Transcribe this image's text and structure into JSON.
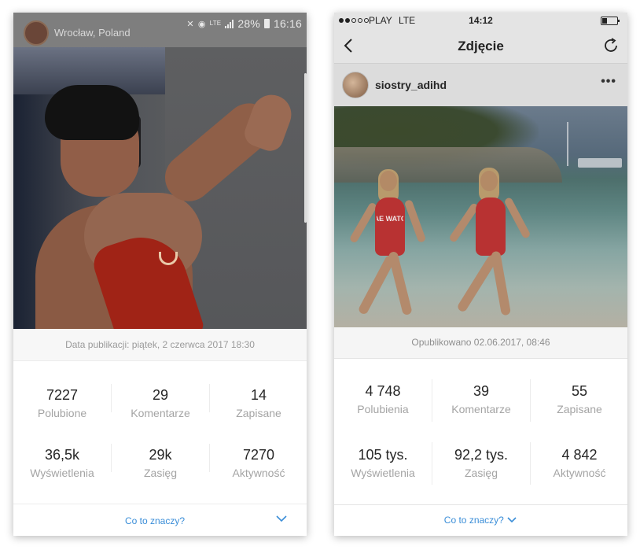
{
  "left_screen": {
    "status_bar": {
      "location": "Wrocław, Poland",
      "network": "LTE",
      "battery": "28%",
      "time": "16:16"
    },
    "publication_date": "Data publikacji: piątek, 2 czerwca 2017 18:30",
    "stats": [
      {
        "value": "7227",
        "label": "Polubione"
      },
      {
        "value": "29",
        "label": "Komentarze"
      },
      {
        "value": "14",
        "label": "Zapisane"
      },
      {
        "value": "36,5k",
        "label": "Wyświetlenia"
      },
      {
        "value": "29k",
        "label": "Zasięg"
      },
      {
        "value": "7270",
        "label": "Aktywność"
      }
    ],
    "help_link": "Co to znaczy?"
  },
  "right_screen": {
    "status_bar": {
      "carrier": "PLAY",
      "network": "LTE",
      "time": "14:12"
    },
    "nav": {
      "title": "Zdjęcie"
    },
    "post": {
      "username": "siostry_adihd",
      "more": "•••",
      "swimsuit_text": "BAE WATCH"
    },
    "publication_date": "Opublikowano 02.06.2017, 08:46",
    "stats": [
      {
        "value": "4 748",
        "label": "Polubienia"
      },
      {
        "value": "39",
        "label": "Komentarze"
      },
      {
        "value": "55",
        "label": "Zapisane"
      },
      {
        "value": "105 tys.",
        "label": "Wyświetlenia"
      },
      {
        "value": "92,2 tys.",
        "label": "Zasięg"
      },
      {
        "value": "4 842",
        "label": "Aktywność"
      }
    ],
    "help_link": "Co to znaczy?"
  }
}
